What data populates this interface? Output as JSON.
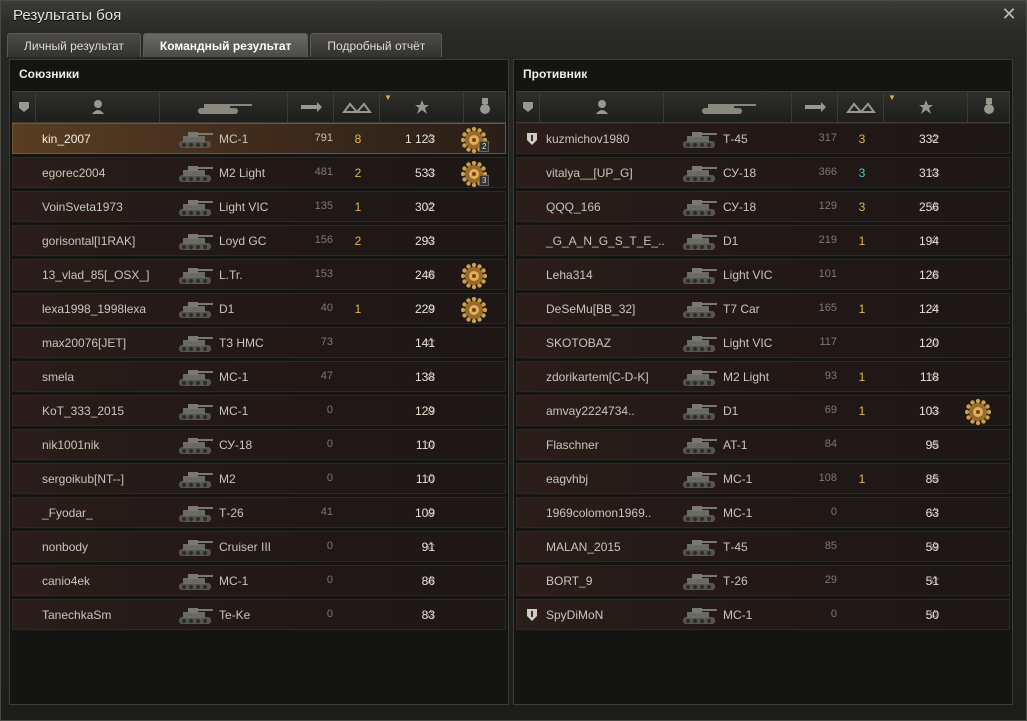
{
  "window": {
    "title": "Результаты боя"
  },
  "tabs": [
    {
      "label": "Личный результат",
      "active": false
    },
    {
      "label": "Командный результат",
      "active": true
    },
    {
      "label": "Подробный отчёт",
      "active": false
    }
  ],
  "allies": {
    "title": "Союзники",
    "rows": [
      {
        "player": "kin_2007",
        "vehicle": "МС-1",
        "damage": "791",
        "kills": "8",
        "xp": "1 123",
        "medal": true,
        "medal_count": "2",
        "highlight": true
      },
      {
        "player": "egorec2004",
        "vehicle": "M2 Light",
        "damage": "481",
        "kills": "2",
        "xp": "533",
        "medal": true,
        "medal_count": "3"
      },
      {
        "player": "VoinSveta1973",
        "vehicle": "Light VIC",
        "damage": "135",
        "kills": "1",
        "xp": "302"
      },
      {
        "player": "gorisontal[I1RAK]",
        "vehicle": "Loyd GC",
        "damage": "156",
        "kills": "2",
        "xp": "293"
      },
      {
        "player": "13_vlad_85[_OSX_]",
        "vehicle": "L.Tr.",
        "damage": "153",
        "kills": "",
        "xp": "246",
        "medal": true
      },
      {
        "player": "lexa1998_1998lexa",
        "vehicle": "D1",
        "damage": "40",
        "kills": "1",
        "xp": "229",
        "medal": true
      },
      {
        "player": "max20076[JET]",
        "vehicle": "T3 HMC",
        "damage": "73",
        "kills": "",
        "xp": "141"
      },
      {
        "player": "smela",
        "vehicle": "МС-1",
        "damage": "47",
        "kills": "",
        "xp": "138"
      },
      {
        "player": "KoT_333_2015",
        "vehicle": "МС-1",
        "damage": "0",
        "kills": "",
        "xp": "129"
      },
      {
        "player": "nik1001nik",
        "vehicle": "СУ-18",
        "damage": "0",
        "kills": "",
        "xp": "110"
      },
      {
        "player": "sergoikub[NT--]",
        "vehicle": "M2",
        "damage": "0",
        "kills": "",
        "xp": "110"
      },
      {
        "player": "_Fyodar_",
        "vehicle": "Т-26",
        "damage": "41",
        "kills": "",
        "xp": "109"
      },
      {
        "player": "nonbody",
        "vehicle": "Cruiser III",
        "damage": "0",
        "kills": "",
        "xp": "91"
      },
      {
        "player": "canio4ek",
        "vehicle": "МС-1",
        "damage": "0",
        "kills": "",
        "xp": "86"
      },
      {
        "player": "TanechkaSm",
        "vehicle": "Te-Ke",
        "damage": "0",
        "kills": "",
        "xp": "83"
      }
    ]
  },
  "enemies": {
    "title": "Противник",
    "rows": [
      {
        "player": "kuzmichov1980",
        "vehicle": "Т-45",
        "damage": "317",
        "kills": "3",
        "xp": "332",
        "squad": true
      },
      {
        "player": "vitalya__[UP_G]",
        "vehicle": "СУ-18",
        "damage": "366",
        "kills": "3",
        "kills_color": "cyan",
        "xp": "313"
      },
      {
        "player": "QQQ_166",
        "vehicle": "СУ-18",
        "damage": "129",
        "kills": "3",
        "xp": "256"
      },
      {
        "player": "_G_A_N_G_S_T_E_..",
        "vehicle": "D1",
        "damage": "219",
        "kills": "1",
        "xp": "194"
      },
      {
        "player": "Leha314",
        "vehicle": "Light VIC",
        "damage": "101",
        "kills": "",
        "xp": "126"
      },
      {
        "player": "DeSeMu[BB_32]",
        "vehicle": "T7 Car",
        "damage": "165",
        "kills": "1",
        "xp": "124"
      },
      {
        "player": "SKOTOBAZ",
        "vehicle": "Light VIC",
        "damage": "117",
        "kills": "",
        "xp": "120"
      },
      {
        "player": "zdorikartem[C-D-K]",
        "vehicle": "M2 Light",
        "damage": "93",
        "kills": "1",
        "xp": "118"
      },
      {
        "player": "amvay2224734..",
        "vehicle": "D1",
        "damage": "69",
        "kills": "1",
        "xp": "103",
        "medal": true
      },
      {
        "player": "Flaschner",
        "vehicle": "AT-1",
        "damage": "84",
        "kills": "",
        "xp": "95"
      },
      {
        "player": "eagvhbj",
        "vehicle": "МС-1",
        "damage": "108",
        "kills": "1",
        "xp": "85"
      },
      {
        "player": "1969colomon1969..",
        "vehicle": "МС-1",
        "damage": "0",
        "kills": "",
        "xp": "63"
      },
      {
        "player": "MALAN_2015",
        "vehicle": "Т-45",
        "damage": "85",
        "kills": "",
        "xp": "59"
      },
      {
        "player": "BORT_9",
        "vehicle": "Т-26",
        "damage": "29",
        "kills": "",
        "xp": "51"
      },
      {
        "player": "SpyDiMoN",
        "vehicle": "МС-1",
        "damage": "0",
        "kills": "",
        "xp": "50",
        "squad": true
      }
    ]
  },
  "icons": {
    "close": "close-icon",
    "star": "☆",
    "column_icons": [
      "squad-icon",
      "player-icon",
      "tank-icon",
      "damage-icon",
      "kills-icon",
      "xp-icon",
      "medal-icon"
    ]
  },
  "colors": {
    "kills": "#e1b74b",
    "kills_cyan": "#4fc3d8",
    "highlight_row": "#5a3d22"
  }
}
